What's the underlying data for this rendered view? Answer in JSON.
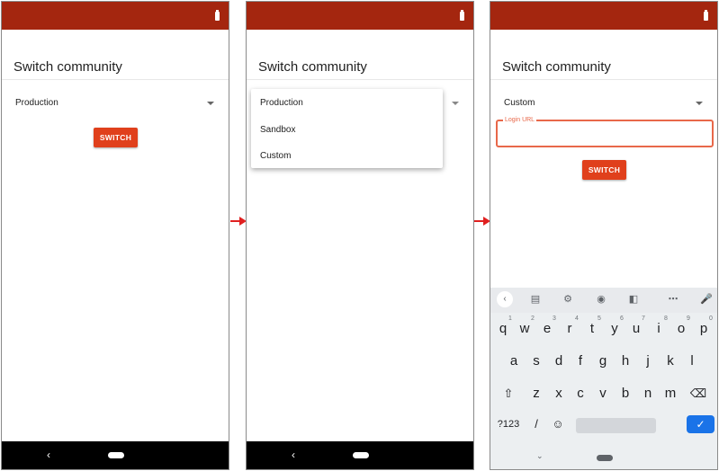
{
  "screens": [
    {
      "title": "Switch community",
      "select_value": "Production",
      "switch_label": "SWITCH",
      "nav_back": "‹"
    },
    {
      "title": "Switch community",
      "dropdown_options": [
        "Production",
        "Sandbox",
        "Custom"
      ],
      "nav_back": "‹"
    },
    {
      "title": "Switch community",
      "select_value": "Custom",
      "login_label": "Login URL",
      "login_value": "",
      "switch_label": "SWITCH",
      "keyboard": {
        "row1": [
          "q",
          "w",
          "e",
          "r",
          "t",
          "y",
          "u",
          "i",
          "o",
          "p"
        ],
        "row1_hints": [
          "1",
          "2",
          "3",
          "4",
          "5",
          "6",
          "7",
          "8",
          "9",
          "0"
        ],
        "row2": [
          "a",
          "s",
          "d",
          "f",
          "g",
          "h",
          "j",
          "k",
          "l"
        ],
        "row3": [
          "z",
          "x",
          "c",
          "v",
          "b",
          "n",
          "m"
        ],
        "symbols_label": "?123",
        "slash": "/",
        "emoji": "☺",
        "enter": "✓"
      }
    }
  ],
  "colors": {
    "status_bar": "#a4260f",
    "accent": "#e0401c",
    "field_border": "#e8684a",
    "enter_key": "#1a73e8",
    "arrow": "#e02020"
  },
  "icons": [
    "battery-icon",
    "dropdown-caret-icon",
    "nav-back-icon",
    "nav-home-icon",
    "clipboard-icon",
    "gear-icon",
    "palette-icon",
    "resize-icon",
    "more-icon",
    "mic-icon",
    "shift-icon",
    "backspace-icon",
    "emoji-icon",
    "check-icon",
    "flow-arrow-icon"
  ]
}
